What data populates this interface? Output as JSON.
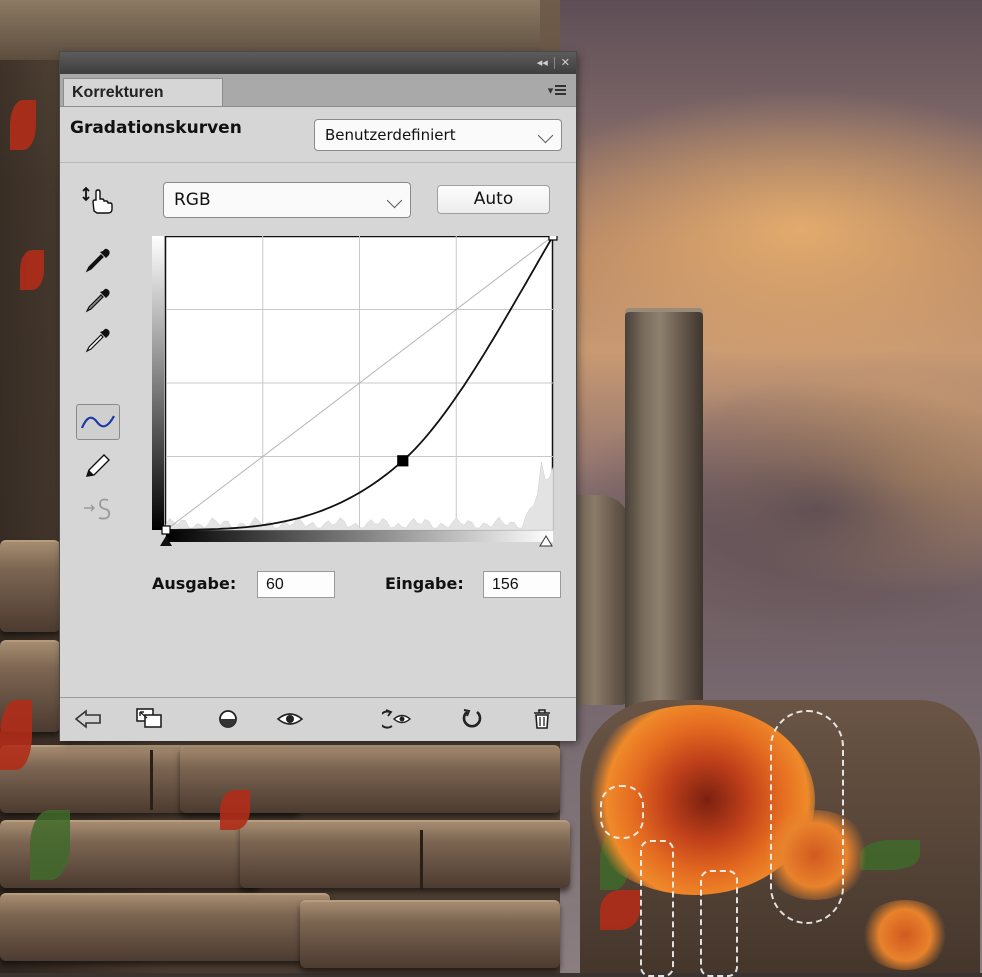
{
  "panel": {
    "tab_label": "Korrekturen",
    "adjustment_title": "Gradationskurven",
    "preset_value": "Benutzerdefiniert",
    "channel_value": "RGB",
    "auto_label": "Auto",
    "output_label": "Ausgabe:",
    "output_value": "60",
    "input_label": "Eingabe:",
    "input_value": "156"
  },
  "curve": {
    "points": [
      [
        0,
        0
      ],
      [
        156,
        60
      ],
      [
        255,
        255
      ]
    ],
    "selected_point": [
      156,
      60
    ],
    "grid_divisions": 4
  },
  "tools": [
    {
      "name": "targeted-adjustment-icon"
    },
    {
      "name": "black-point-eyedropper-icon"
    },
    {
      "name": "gray-point-eyedropper-icon"
    },
    {
      "name": "white-point-eyedropper-icon"
    },
    {
      "name": "curve-point-edit-icon",
      "active": true
    },
    {
      "name": "pencil-draw-icon"
    },
    {
      "name": "smooth-curve-icon",
      "disabled": true
    }
  ],
  "bottom_bar": [
    "return-to-list-icon",
    "expanded-view-icon",
    "clip-to-layer-icon",
    "toggle-visibility-icon",
    "view-previous-state-icon",
    "reset-icon",
    "delete-adjustment-icon"
  ]
}
